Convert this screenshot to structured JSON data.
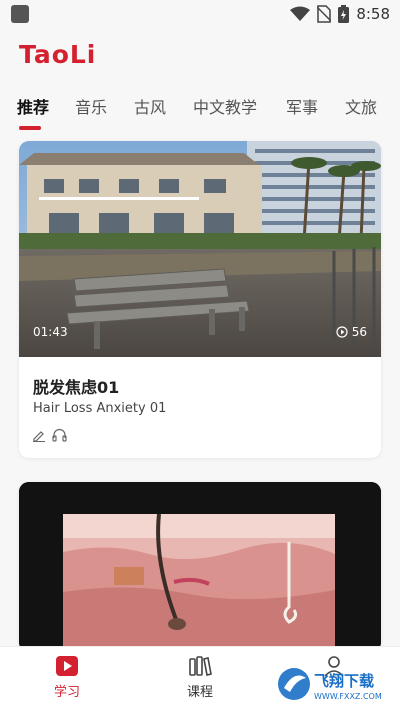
{
  "status_bar": {
    "time": "8:58"
  },
  "app": {
    "title": "TaoLi"
  },
  "tabs": [
    {
      "label": "推荐",
      "active": true
    },
    {
      "label": "音乐",
      "active": false
    },
    {
      "label": "古风",
      "active": false
    },
    {
      "label": "中文教学",
      "active": false
    },
    {
      "label": "军事",
      "active": false
    },
    {
      "label": "文旅",
      "active": false
    }
  ],
  "feed": [
    {
      "duration": "01:43",
      "views": "56",
      "title": "脱发焦虑01",
      "subtitle": "Hair Loss Anxiety 01",
      "icons": [
        "pencil-icon",
        "headphones-icon"
      ]
    }
  ],
  "bottom_nav": {
    "learn_label": "学习",
    "course_label": "课程"
  },
  "watermark": {
    "text": "飞翔下载",
    "url_text": "WWW.FXXZ.COM"
  },
  "colors": {
    "accent": "#d42130",
    "background": "#f7f7f8"
  }
}
